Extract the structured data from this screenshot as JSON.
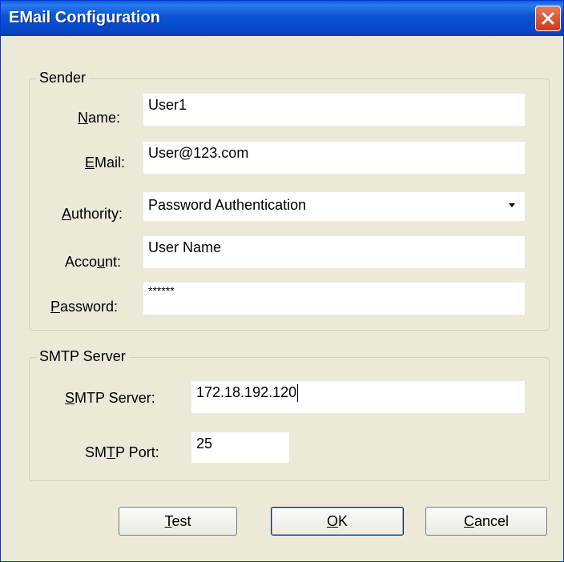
{
  "window": {
    "title": "EMail Configuration"
  },
  "sender": {
    "legend": "Sender",
    "name_label": {
      "key": "N",
      "rest": "ame:"
    },
    "name_value": "User1",
    "email_label": {
      "key": "E",
      "rest": "Mail:"
    },
    "email_value": "User@123.com",
    "authority_label": {
      "key": "A",
      "rest": "uthority:"
    },
    "authority_value": "Password Authentication",
    "account_label": {
      "pre": "Acco",
      "key": "u",
      "rest": "nt:"
    },
    "account_value": "User Name",
    "password_label": {
      "key": "P",
      "rest": "assword:"
    },
    "password_value": "******"
  },
  "smtp": {
    "legend": "SMTP Server",
    "server_label": {
      "key": "S",
      "rest": "MTP Server:"
    },
    "server_value": "172.18.192.120",
    "port_label": {
      "pre": "SM",
      "key": "T",
      "rest": "P Port:"
    },
    "port_value": "25"
  },
  "buttons": {
    "test": {
      "key": "T",
      "rest": "est"
    },
    "ok": {
      "key": "O",
      "rest": "K"
    },
    "cancel": {
      "key": "C",
      "rest": "ancel"
    }
  },
  "icons": {
    "close": "close-icon",
    "dropdown": "chevron-down-icon"
  },
  "colors": {
    "titlebar": "#0a5fd8",
    "close_button": "#cc3a18",
    "dialog_bg": "#ece9d8"
  }
}
